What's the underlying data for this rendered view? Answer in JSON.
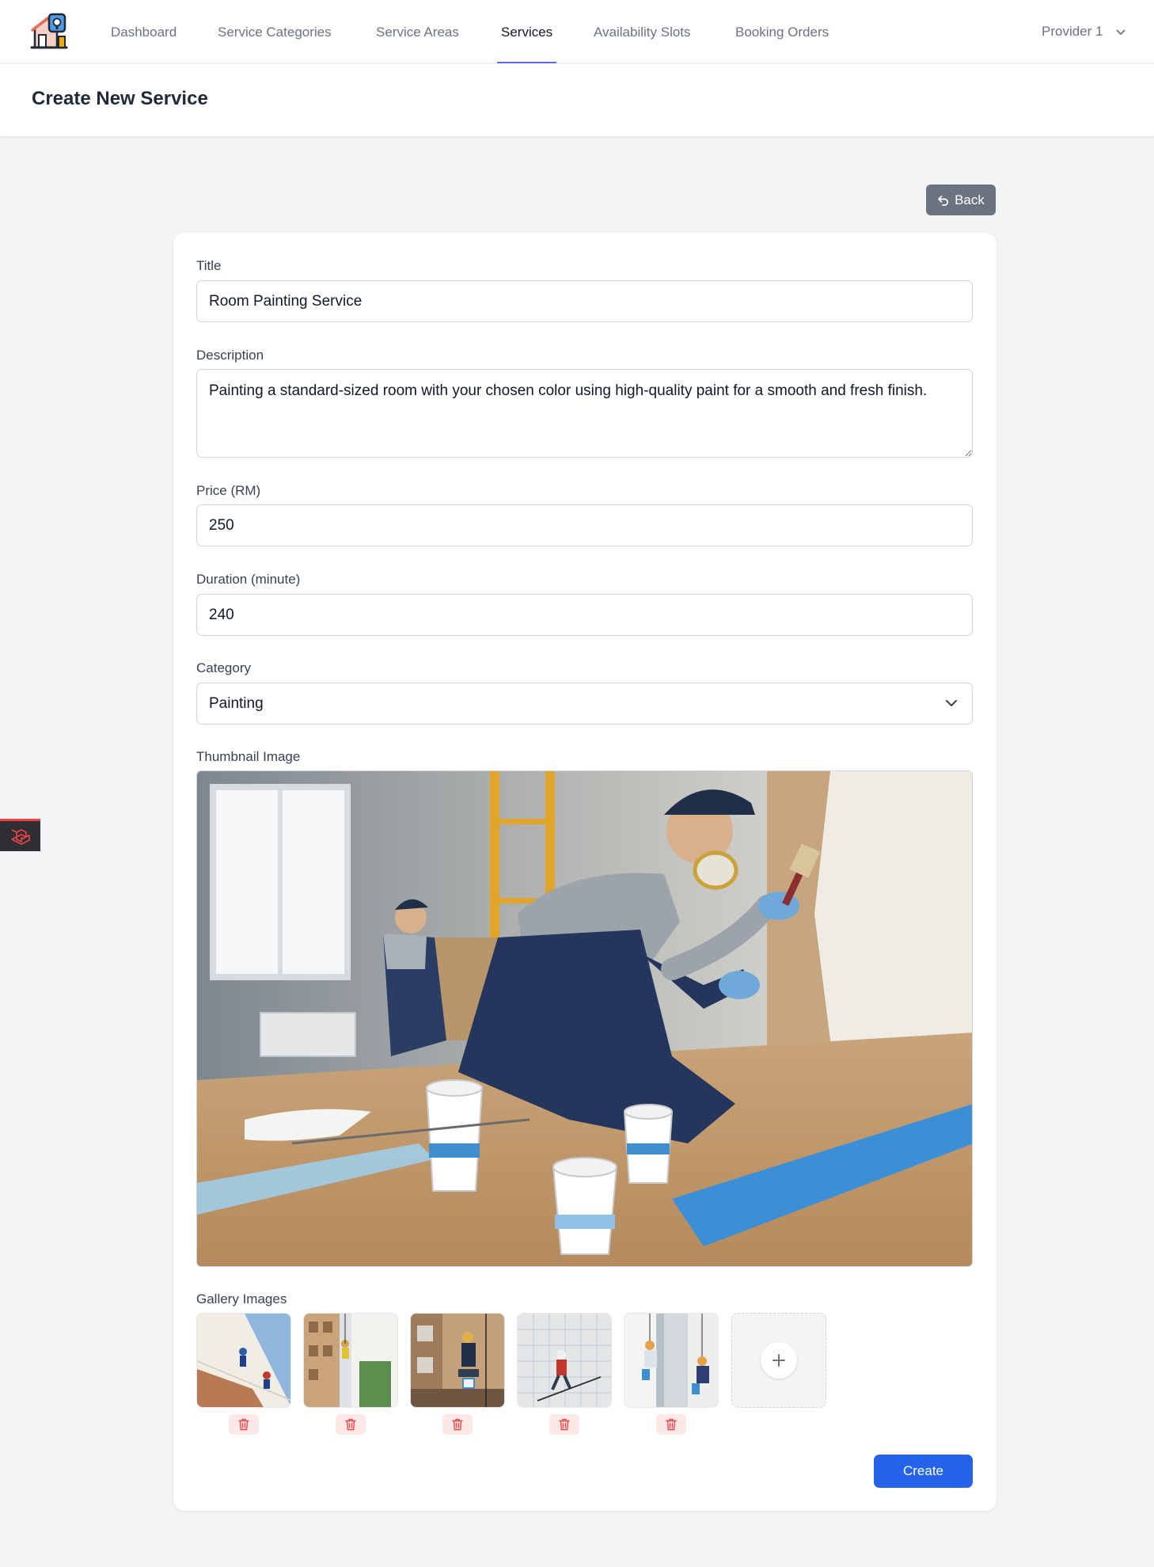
{
  "nav": {
    "items": [
      {
        "label": "Dashboard",
        "active": false
      },
      {
        "label": "Service Categories",
        "active": false
      },
      {
        "label": "Service Areas",
        "active": false
      },
      {
        "label": "Services",
        "active": true
      },
      {
        "label": "Availability Slots",
        "active": false
      },
      {
        "label": "Booking Orders",
        "active": false
      }
    ],
    "user": "Provider 1",
    "accent": "#6366f1"
  },
  "header": {
    "title": "Create New Service"
  },
  "back_button": {
    "label": "Back",
    "icon": "undo-arrow-icon"
  },
  "form": {
    "title": {
      "label": "Title",
      "value": "Room Painting Service"
    },
    "description": {
      "label": "Description",
      "value": "Painting a standard-sized room with your chosen color using high-quality paint for a smooth and fresh finish."
    },
    "price": {
      "label": "Price (RM)",
      "value": "250"
    },
    "duration": {
      "label": "Duration (minute)",
      "value": "240"
    },
    "category": {
      "label": "Category",
      "value": "Painting",
      "icon": "chevron-down-icon"
    },
    "thumbnail": {
      "label": "Thumbnail Image"
    },
    "gallery": {
      "label": "Gallery Images",
      "count": 5,
      "delete_icon": "trash-icon",
      "add_icon": "plus-icon"
    },
    "submit_label": "Create"
  },
  "colors": {
    "primary": "#2563eb",
    "secondary_button": "#6b7280",
    "danger": "#ef4444",
    "page_bg": "#f3f4f6"
  }
}
